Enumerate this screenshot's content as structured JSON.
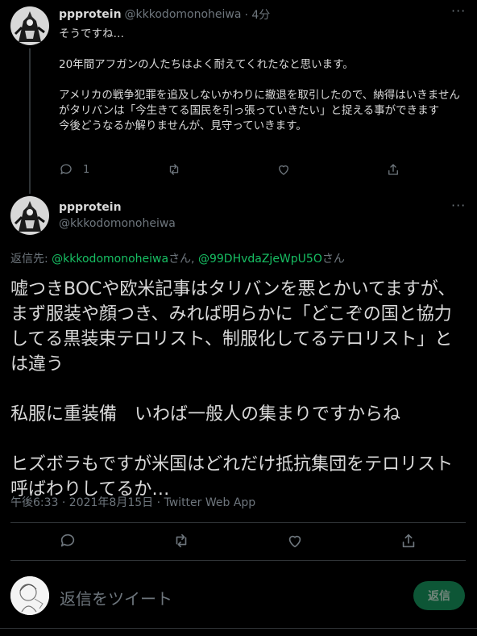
{
  "colors": {
    "background": "#000000",
    "text": "#d9d9d9",
    "muted": "#6e767d",
    "mention": "#17bf63",
    "reply_button_bg": "#127349"
  },
  "first_tweet": {
    "display_name": "ppprotein",
    "handle": "@kkkodomonoheiwa",
    "time": "· 4分",
    "text": "そうですね…\n\n20年間アフガンの人たちはよく耐えてくれたなと思います。\n\nアメリカの戦争犯罪を追及しないかわりに撤退を取引したので、納得はいきませんがタリバンは「今生きてる国民を引っ張っていきたい」と捉える事ができます\n今後どうなるか解りませんが、見守っていきます。",
    "reply_count": "1",
    "icons": [
      "reply-icon",
      "retweet-icon",
      "like-icon",
      "share-icon"
    ]
  },
  "main_tweet": {
    "display_name": "ppprotein",
    "handle": "@kkkodomonoheiwa",
    "replying_prefix": "返信先: ",
    "replying_mention1": "@kkkodomonoheiwa",
    "replying_san1": "さん, ",
    "replying_mention2": "@99DHvdaZjeWpU5O",
    "replying_san2": "さん",
    "text": "嘘つきBOCや欧米記事はタリバンを悪とかいてますが、まず服装や顔つき、みれば明らかに「どこぞの国と協力してる黒装束テロリスト、制服化してるテロリスト」とは違う\n\n私服に重装備　いわば一般人の集まりですからね\n\nヒズボラもですが米国はどれだけ抵抗集団をテロリスト呼ばわりしてるか…",
    "meta": "午後6:33 · 2021年8月15日 · Twitter Web App"
  },
  "reply_box": {
    "placeholder": "返信をツイート",
    "button_label": "返信"
  }
}
